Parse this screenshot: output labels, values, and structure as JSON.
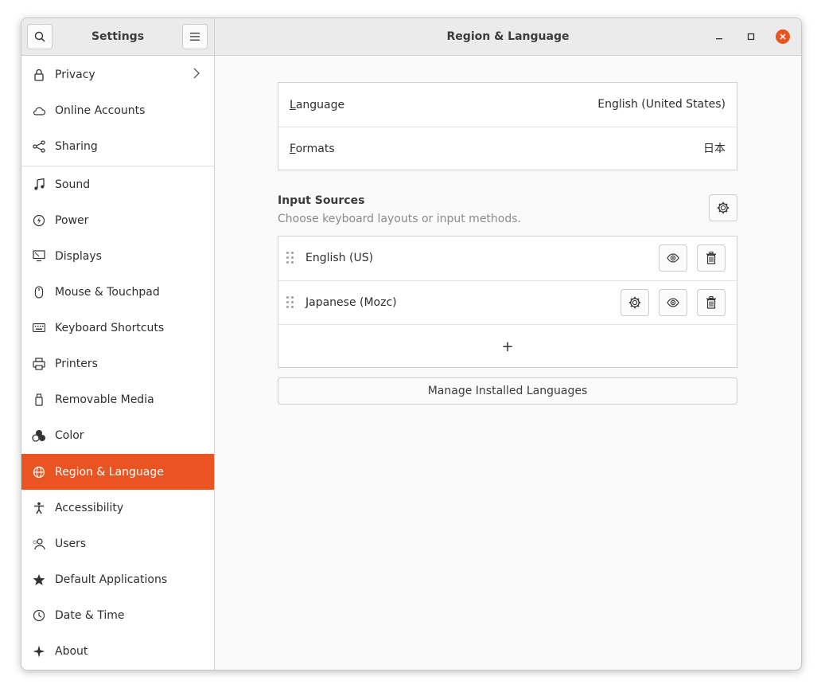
{
  "header": {
    "sidebar_title": "Settings",
    "main_title": "Region & Language"
  },
  "sidebar": {
    "items": [
      {
        "label": "Privacy",
        "icon": "lock-icon"
      },
      {
        "label": "Online Accounts",
        "icon": "cloud-icon"
      },
      {
        "label": "Sharing",
        "icon": "share-icon"
      },
      {
        "label": "Sound",
        "icon": "music-note-icon"
      },
      {
        "label": "Power",
        "icon": "power-icon"
      },
      {
        "label": "Displays",
        "icon": "display-icon"
      },
      {
        "label": "Mouse & Touchpad",
        "icon": "mouse-icon"
      },
      {
        "label": "Keyboard Shortcuts",
        "icon": "keyboard-icon"
      },
      {
        "label": "Printers",
        "icon": "printer-icon"
      },
      {
        "label": "Removable Media",
        "icon": "usb-icon"
      },
      {
        "label": "Color",
        "icon": "color-icon"
      },
      {
        "label": "Region & Language",
        "icon": "globe-icon",
        "active": true
      },
      {
        "label": "Accessibility",
        "icon": "accessibility-icon"
      },
      {
        "label": "Users",
        "icon": "users-icon"
      },
      {
        "label": "Default Applications",
        "icon": "star-icon"
      },
      {
        "label": "Date & Time",
        "icon": "clock-icon"
      },
      {
        "label": "About",
        "icon": "sparkle-icon"
      }
    ]
  },
  "main": {
    "language": {
      "label_first": "L",
      "label_rest": "anguage",
      "value": "English (United States)"
    },
    "formats": {
      "label_first": "F",
      "label_rest": "ormats",
      "value": "日本"
    },
    "input_sources": {
      "title": "Input Sources",
      "subtitle": "Choose keyboard layouts or input methods.",
      "sources": [
        {
          "label": "English (US)"
        },
        {
          "label": "Japanese (Mozc)"
        }
      ],
      "add_symbol": "+"
    },
    "manage_button": "Manage Installed Languages"
  },
  "colors": {
    "accent": "#e95420",
    "header_bg": "#ebebeb",
    "content_bg": "#fafafa"
  }
}
